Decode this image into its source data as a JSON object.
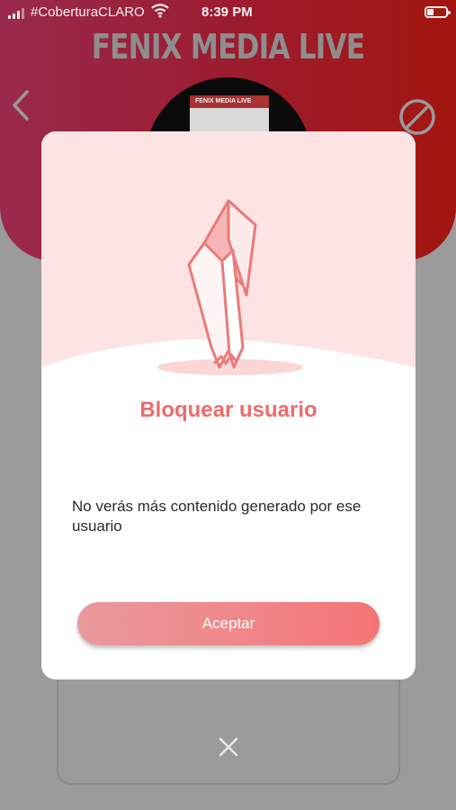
{
  "status_bar": {
    "carrier": "#CoberturaCLARO",
    "time": "8:39 PM"
  },
  "header": {
    "app_title": "FENIX MEDIA LIVE",
    "avatar_thumbnail_text": "FENIX MEDIA LIVE"
  },
  "modal": {
    "title": "Bloquear usuario",
    "message": "No verás más contenido generado por ese usuario",
    "accept_label": "Aceptar"
  },
  "icons": {
    "back": "chevron-left-icon",
    "block": "block-icon",
    "close": "close-icon",
    "illustration": "paper-tear-illustration"
  },
  "colors": {
    "accent": "#ee6b6b",
    "header_start": "#9a2a4c",
    "header_end": "#a3150f",
    "overlay": "#9b9b9b"
  }
}
